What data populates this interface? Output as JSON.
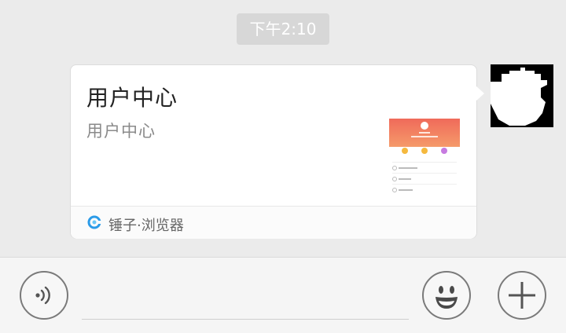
{
  "chat": {
    "timestamp": "下午2:10"
  },
  "link_card": {
    "title": "用户中心",
    "description": "用户中心",
    "source_app": "锤子·浏览器",
    "thumbnail_icon": "webpage-preview-thumbnail"
  },
  "sender": {
    "avatar_icon": "user-avatar-icon"
  },
  "input_bar": {
    "voice_icon": "voice-input-icon",
    "emoji_icon": "emoji-icon",
    "plus_icon": "plus-icon",
    "text_value": ""
  },
  "colors": {
    "background": "#ebebeb",
    "card": "#ffffff",
    "badge": "#d7d7d7",
    "thumb_header": "#f06a5a",
    "app_icon": "#2b9be8"
  }
}
